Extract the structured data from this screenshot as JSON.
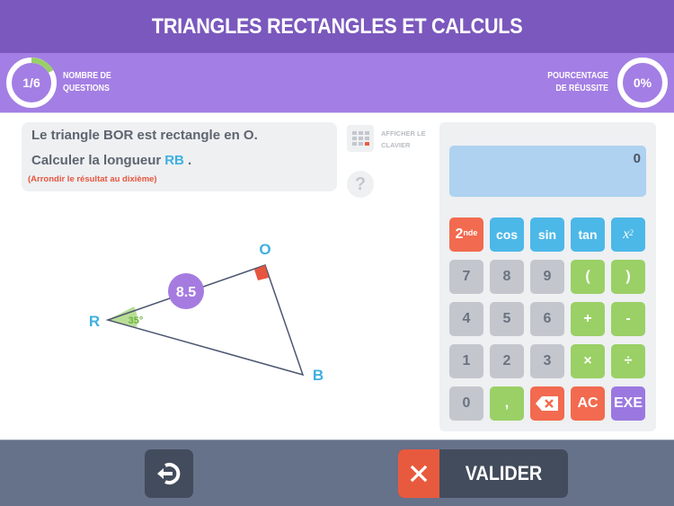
{
  "header": {
    "title": "TRIANGLES RECTANGLES ET CALCULS"
  },
  "stats": {
    "questions": {
      "value_text": "1/6",
      "current": 1,
      "total": 6,
      "label_line1": "NOMBRE DE",
      "label_line2": "QUESTIONS",
      "progress_fraction": 0.1667,
      "progress_color": "#9ad066"
    },
    "success": {
      "value_text": "0%",
      "percent": 0,
      "label_line1": "POURCENTAGE",
      "label_line2": "DE RÉUSSITE"
    }
  },
  "question": {
    "line1": "Le triangle BOR est rectangle en O.",
    "line2_prefix": "Calculer la longueur",
    "line2_target": "RB",
    "line2_suffix": " .",
    "hint": "(Arrondir le résultat au dixième)"
  },
  "tools": {
    "keyboard_label_line1": "AFFICHER LE",
    "keyboard_label_line2": "CLAVIER",
    "help_symbol": "?"
  },
  "figure": {
    "vertices": {
      "R": "R",
      "O": "O",
      "B": "B"
    },
    "known_side": "RO",
    "known_side_value": "8.5",
    "angle_vertex": "R",
    "angle_label": "35°",
    "right_angle_vertex": "O",
    "colors": {
      "vertex_label": "#3fb0e0",
      "side_badge": "#a57be0",
      "angle_fill": "#b9de98",
      "angle_text": "#6cb33e",
      "right_angle": "#e8553f",
      "edge": "#4c5670"
    }
  },
  "calculator": {
    "display": "0",
    "keys": [
      {
        "label": "2",
        "sup": "nde",
        "type": "red",
        "name": "key-second"
      },
      {
        "label": "cos",
        "type": "fn",
        "name": "key-cos"
      },
      {
        "label": "sin",
        "type": "fn",
        "name": "key-sin"
      },
      {
        "label": "tan",
        "type": "fn",
        "name": "key-tan"
      },
      {
        "label": "x",
        "sup": "2",
        "type": "fn x2",
        "name": "key-square"
      },
      {
        "label": "7",
        "type": "num",
        "name": "key-7"
      },
      {
        "label": "8",
        "type": "num",
        "name": "key-8"
      },
      {
        "label": "9",
        "type": "num",
        "name": "key-9"
      },
      {
        "label": "(",
        "type": "op",
        "name": "key-open-paren"
      },
      {
        "label": ")",
        "type": "op",
        "name": "key-close-paren"
      },
      {
        "label": "4",
        "type": "num",
        "name": "key-4"
      },
      {
        "label": "5",
        "type": "num",
        "name": "key-5"
      },
      {
        "label": "6",
        "type": "num",
        "name": "key-6"
      },
      {
        "label": "+",
        "type": "op",
        "name": "key-plus"
      },
      {
        "label": "-",
        "type": "op",
        "name": "key-minus"
      },
      {
        "label": "1",
        "type": "num",
        "name": "key-1"
      },
      {
        "label": "2",
        "type": "num",
        "name": "key-2"
      },
      {
        "label": "3",
        "type": "num",
        "name": "key-3"
      },
      {
        "label": "×",
        "type": "op",
        "name": "key-multiply"
      },
      {
        "label": "÷",
        "type": "op",
        "name": "key-divide"
      },
      {
        "label": "0",
        "type": "num",
        "name": "key-0"
      },
      {
        "label": ",",
        "type": "op",
        "name": "key-comma"
      },
      {
        "label": "",
        "icon": "backspace-icon",
        "type": "red",
        "name": "key-backspace"
      },
      {
        "label": "AC",
        "type": "red",
        "name": "key-clear"
      },
      {
        "label": "EXE",
        "type": "purple",
        "name": "key-execute"
      }
    ]
  },
  "footer": {
    "back_icon": "exit-arrow-icon",
    "validate_label": "VALIDER",
    "validate_status_icon": "close-icon"
  }
}
